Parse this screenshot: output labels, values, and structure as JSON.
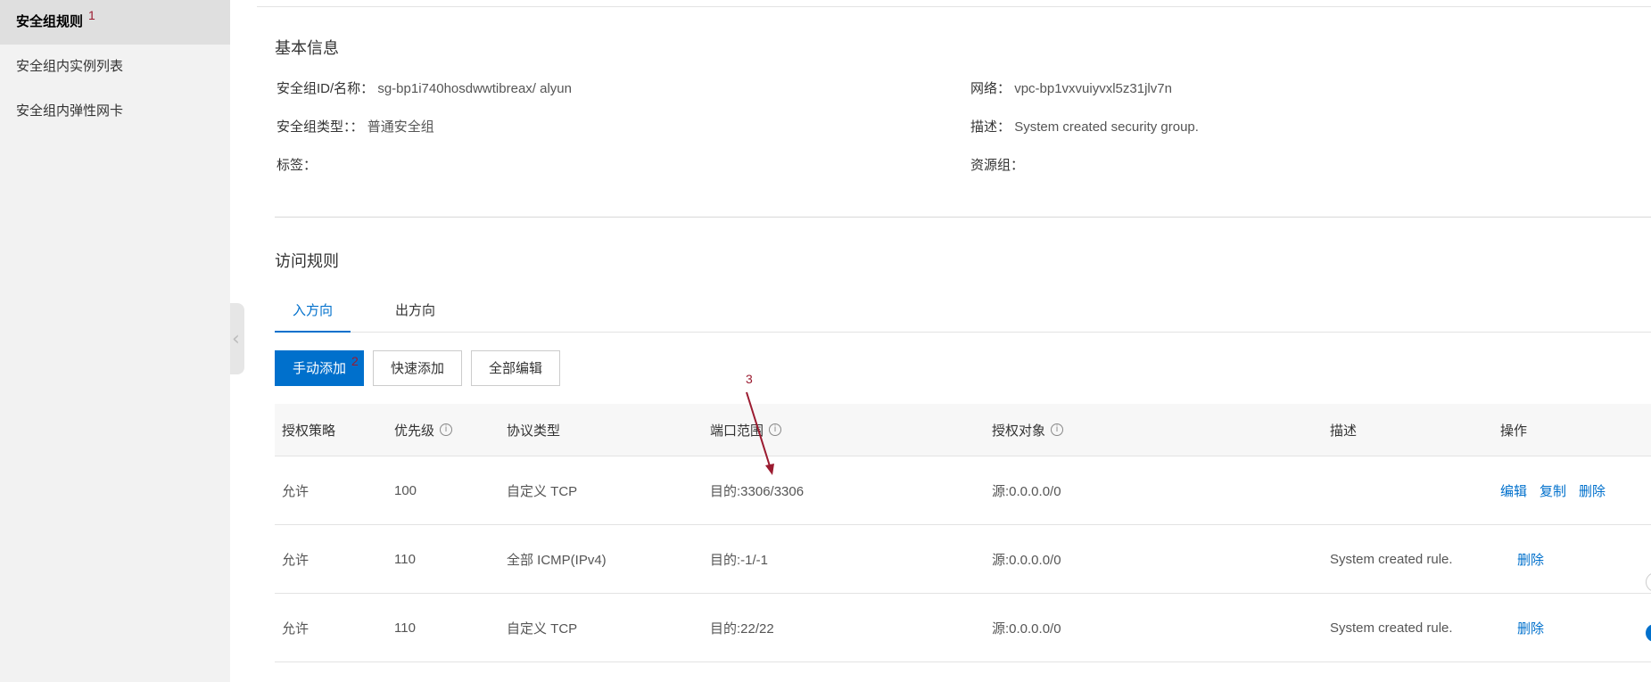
{
  "sidebar": {
    "items": [
      {
        "label": "安全组规则",
        "badge": "1"
      },
      {
        "label": "安全组内实例列表"
      },
      {
        "label": "安全组内弹性网卡"
      }
    ],
    "collapse_icon": "chevron-left-icon"
  },
  "basic_info": {
    "title": "基本信息",
    "id_label": "安全组ID/名称：",
    "id_value": "sg-bp1i740hosdwwtibreax/ alyun",
    "network_label": "网络：",
    "network_value": "vpc-bp1vxvuiyvxl5z31jlv7n",
    "type_label": "安全组类型：：",
    "type_value": "普通安全组",
    "desc_label": "描述：",
    "desc_value": "System created security group.",
    "tag_label": "标签：",
    "resource_group_label": "资源组："
  },
  "access_rules": {
    "title": "访问规则",
    "tabs": [
      {
        "label": "入方向",
        "active": true
      },
      {
        "label": "出方向",
        "active": false
      }
    ],
    "buttons": {
      "manual_add": "手动添加",
      "manual_add_badge": "2",
      "quick_add": "快速添加",
      "edit_all": "全部编辑"
    },
    "annotation_3": "3",
    "columns": [
      "授权策略",
      "优先级",
      "协议类型",
      "端口范围",
      "授权对象",
      "描述",
      "操作"
    ],
    "rows": [
      {
        "policy": "允许",
        "priority": "100",
        "protocol": "自定义 TCP",
        "port": "目的:3306/3306",
        "object": "源:0.0.0.0/0",
        "desc": "",
        "actions": [
          "编辑",
          "复制",
          "删除"
        ]
      },
      {
        "policy": "允许",
        "priority": "110",
        "protocol": "全部 ICMP(IPv4)",
        "port": "目的:-1/-1",
        "object": "源:0.0.0.0/0",
        "desc": "System created rule.",
        "actions": [
          "删除"
        ]
      },
      {
        "policy": "允许",
        "priority": "110",
        "protocol": "自定义 TCP",
        "port": "目的:22/22",
        "object": "源:0.0.0.0/0",
        "desc": "System created rule.",
        "actions": [
          "删除"
        ]
      }
    ]
  },
  "colors": {
    "accent": "#0070cc",
    "annotation": "#9b1b30",
    "sidebar_bg": "#f2f2f2"
  }
}
